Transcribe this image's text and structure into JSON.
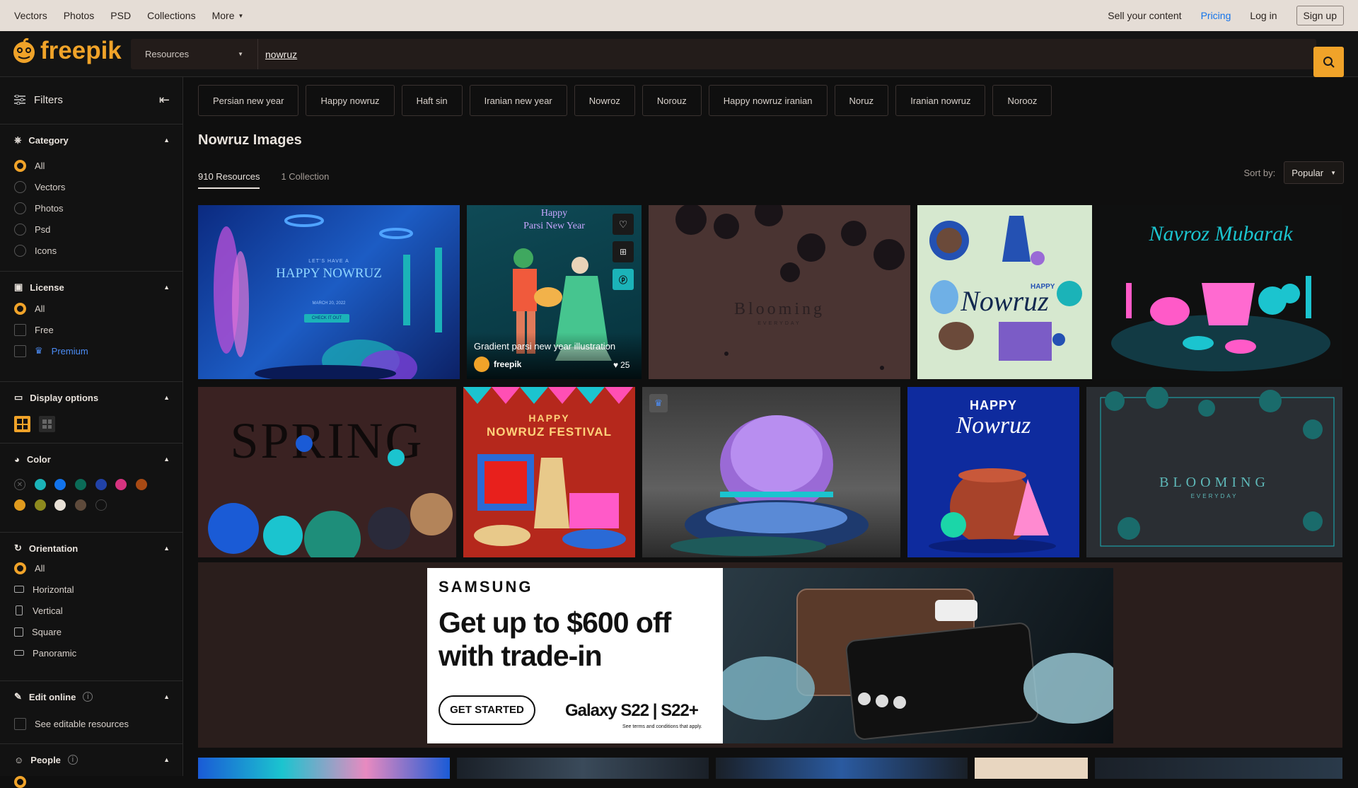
{
  "topbar": {
    "nav": [
      "Vectors",
      "Photos",
      "PSD",
      "Collections",
      "More"
    ],
    "sell": "Sell your content",
    "pricing": "Pricing",
    "login": "Log in",
    "signup": "Sign up"
  },
  "header": {
    "logo_text": "freepik",
    "resource_select": "Resources",
    "search_value": "nowruz"
  },
  "sidebar": {
    "title": "Filters",
    "category": {
      "title": "Category",
      "options": [
        "All",
        "Vectors",
        "Photos",
        "Psd",
        "Icons"
      ],
      "selected": "All"
    },
    "license": {
      "title": "License",
      "options": [
        "All",
        "Free",
        "Premium"
      ],
      "selected": "All"
    },
    "display": {
      "title": "Display options"
    },
    "color": {
      "title": "Color",
      "swatches": [
        "#1bb3b8",
        "#1273eb",
        "#0b6b57",
        "#2142a8",
        "#d6337f",
        "#a84a14",
        "#e09b1e",
        "#8d8a1e",
        "#e8e0d6",
        "#5e4a3b",
        "#111111"
      ]
    },
    "orientation": {
      "title": "Orientation",
      "options": [
        "All",
        "Horizontal",
        "Vertical",
        "Square",
        "Panoramic"
      ],
      "selected": "All"
    },
    "edit_online": {
      "title": "Edit online",
      "option": "See editable resources"
    },
    "people": {
      "title": "People"
    }
  },
  "tags": [
    "Persian new year",
    "Happy nowruz",
    "Haft sin",
    "Iranian new year",
    "Nowroz",
    "Norouz",
    "Happy nowruz iranian",
    "Noruz",
    "Iranian nowruz",
    "Norooz"
  ],
  "main": {
    "title": "Nowruz Images",
    "tab_resources": "910 Resources",
    "tab_collection": "1 Collection",
    "sort_label": "Sort by:",
    "sort_value": "Popular"
  },
  "cards": {
    "c1_sub": "LET'S HAVE A",
    "c1_title": "HAPPY NOWRUZ",
    "c1_date": "MARCH 20, 2022",
    "c1_btn": "CHECK IT OUT",
    "c2_top": "Happy",
    "c2_top2": "Parsi New Year",
    "c2_caption": "Gradient parsi new year illustration",
    "c2_author": "freepik",
    "c2_likes": "25",
    "c3_text": "Blooming",
    "c3_sub": "EVERYDAY",
    "c4_text": "Nowruz",
    "c4_happy": "HAPPY",
    "c5_text": "Navroz Mubarak",
    "c6_text": "SPRING",
    "c7_happy": "HAPPY",
    "c7_text": "NOWRUZ FESTIVAL",
    "c9_happy": "HAPPY",
    "c9_text": "Nowruz",
    "c10_text": "BLOOMING",
    "c10_sub": "EVERYDAY"
  },
  "ad": {
    "brand": "SAMSUNG",
    "headline1": "Get up to $600 off",
    "headline2": "with trade-in",
    "cta": "GET STARTED",
    "product": "Galaxy S22 | S22+",
    "terms": "See terms and conditions that apply."
  }
}
